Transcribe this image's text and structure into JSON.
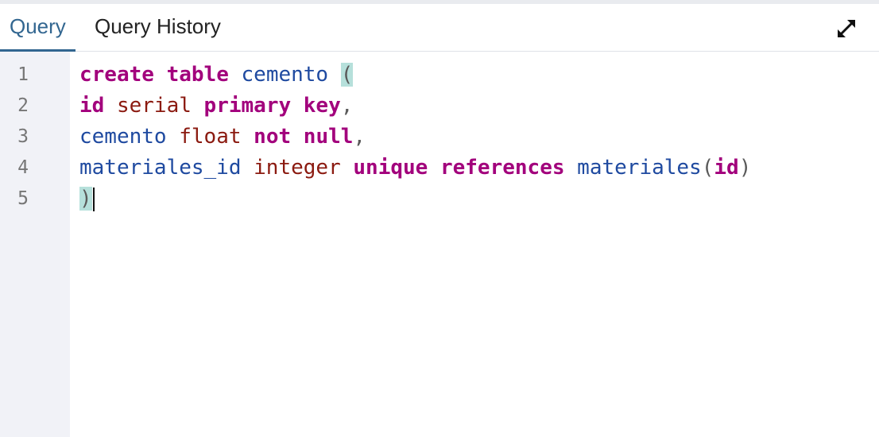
{
  "tabs": {
    "query_label": "Query",
    "history_label": "Query History",
    "active": "Query"
  },
  "toolbar": {
    "expand_icon": "expand-diagonal-arrows-icon"
  },
  "editor": {
    "line_numbers": [
      "1",
      "2",
      "3",
      "4",
      "5"
    ],
    "lines": [
      [
        {
          "t": "create",
          "c": "kw"
        },
        {
          "t": " ",
          "c": "sp"
        },
        {
          "t": "table",
          "c": "kw"
        },
        {
          "t": " ",
          "c": "sp"
        },
        {
          "t": "cemento",
          "c": "ident"
        },
        {
          "t": " ",
          "c": "sp"
        },
        {
          "t": "(",
          "c": "punct match"
        }
      ],
      [
        {
          "t": "id",
          "c": "kw"
        },
        {
          "t": " ",
          "c": "sp"
        },
        {
          "t": "serial",
          "c": "type"
        },
        {
          "t": " ",
          "c": "sp"
        },
        {
          "t": "primary",
          "c": "kw"
        },
        {
          "t": " ",
          "c": "sp"
        },
        {
          "t": "key",
          "c": "kw"
        },
        {
          "t": ",",
          "c": "punct"
        }
      ],
      [
        {
          "t": "cemento",
          "c": "ident"
        },
        {
          "t": " ",
          "c": "sp"
        },
        {
          "t": "float",
          "c": "type"
        },
        {
          "t": " ",
          "c": "sp"
        },
        {
          "t": "not",
          "c": "kw"
        },
        {
          "t": " ",
          "c": "sp"
        },
        {
          "t": "null",
          "c": "kw"
        },
        {
          "t": ",",
          "c": "punct"
        }
      ],
      [
        {
          "t": "materiales_id",
          "c": "ident"
        },
        {
          "t": " ",
          "c": "sp"
        },
        {
          "t": "integer",
          "c": "type"
        },
        {
          "t": " ",
          "c": "sp"
        },
        {
          "t": "unique",
          "c": "kw"
        },
        {
          "t": " ",
          "c": "sp"
        },
        {
          "t": "references",
          "c": "kw"
        },
        {
          "t": " ",
          "c": "sp"
        },
        {
          "t": "materiales",
          "c": "ident"
        },
        {
          "t": "(",
          "c": "punct"
        },
        {
          "t": "id",
          "c": "kw"
        },
        {
          "t": ")",
          "c": "punct"
        }
      ],
      [
        {
          "t": ")",
          "c": "punct match"
        }
      ]
    ],
    "cursor_line": 5
  },
  "colors": {
    "tab_active": "#326690",
    "keyword": "#a2007c",
    "type": "#8b1a10",
    "identifier": "#1f4aa0",
    "bracket_match": "#b6e0db",
    "gutter_bg": "#f1f2f7"
  }
}
